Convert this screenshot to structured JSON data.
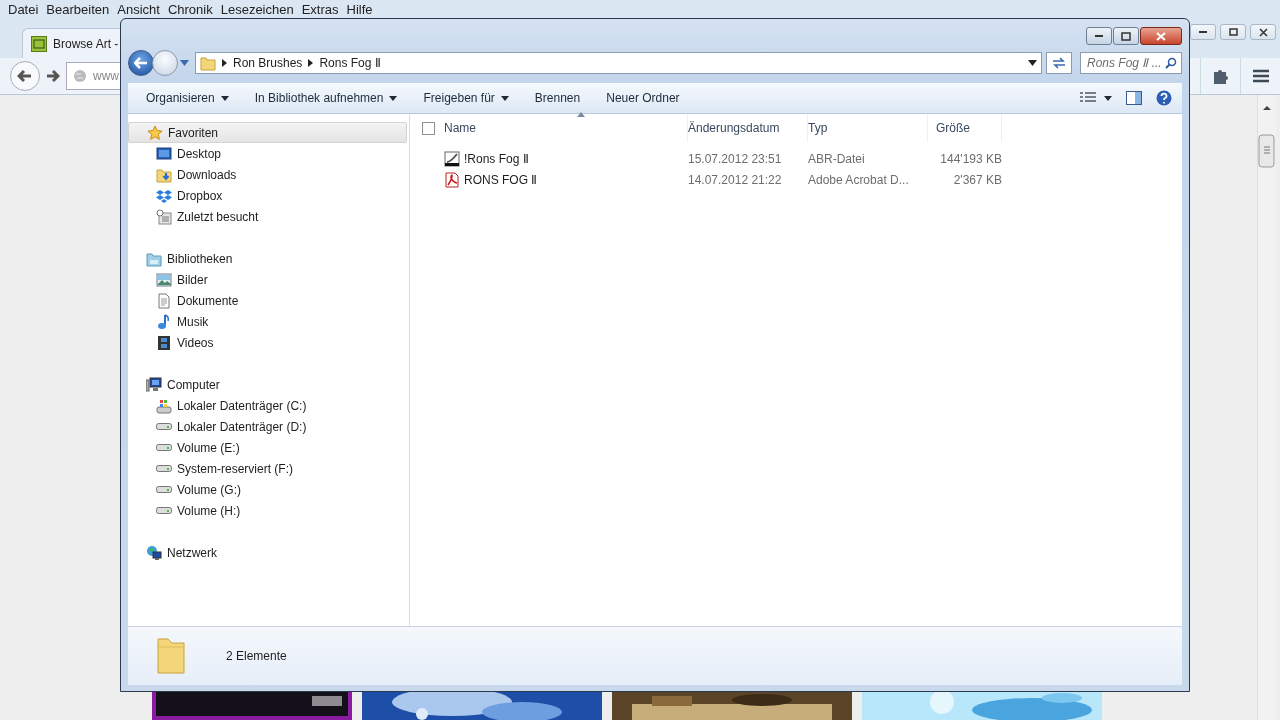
{
  "browser": {
    "menu": [
      "Datei",
      "Bearbeiten",
      "Ansicht",
      "Chronik",
      "Lesezeichen",
      "Extras",
      "Hilfe"
    ],
    "tab": {
      "title": "Browse Art -"
    },
    "url": "www"
  },
  "explorer": {
    "address": {
      "crumbs": [
        "Ron Brushes",
        "Rons Fog Ⅱ"
      ]
    },
    "search": {
      "placeholder": "Rons Fog Ⅱ ..."
    },
    "toolbar": [
      {
        "label": "Organisieren",
        "dropdown": true
      },
      {
        "label": "In Bibliothek aufnehmen",
        "dropdown": true
      },
      {
        "label": "Freigeben für",
        "dropdown": true
      },
      {
        "label": "Brennen",
        "dropdown": false
      },
      {
        "label": "Neuer Ordner",
        "dropdown": false
      }
    ],
    "nav": [
      {
        "label": "Favoriten",
        "kind": "star",
        "highlighted": true,
        "children": [
          {
            "label": "Desktop",
            "kind": "desktop"
          },
          {
            "label": "Downloads",
            "kind": "downloads"
          },
          {
            "label": "Dropbox",
            "kind": "dropbox"
          },
          {
            "label": "Zuletzt besucht",
            "kind": "recent"
          }
        ]
      },
      {
        "label": "Bibliotheken",
        "kind": "library",
        "highlighted": false,
        "children": [
          {
            "label": "Bilder",
            "kind": "pictures"
          },
          {
            "label": "Dokumente",
            "kind": "documents"
          },
          {
            "label": "Musik",
            "kind": "music"
          },
          {
            "label": "Videos",
            "kind": "videos"
          }
        ]
      },
      {
        "label": "Computer",
        "kind": "computer",
        "highlighted": false,
        "children": [
          {
            "label": "Lokaler Datenträger (C:)",
            "kind": "drive-windows"
          },
          {
            "label": "Lokaler Datenträger (D:)",
            "kind": "drive"
          },
          {
            "label": "Volume (E:)",
            "kind": "drive"
          },
          {
            "label": "System-reserviert (F:)",
            "kind": "drive"
          },
          {
            "label": "Volume (G:)",
            "kind": "drive"
          },
          {
            "label": "Volume (H:)",
            "kind": "drive"
          }
        ]
      },
      {
        "label": "Netzwerk",
        "kind": "network",
        "highlighted": false
      }
    ],
    "select_all": {
      "checked": false
    },
    "columns": [
      {
        "label": "Name",
        "sorted": true
      },
      {
        "label": "Änderungsdatum",
        "sorted": false
      },
      {
        "label": "Typ",
        "sorted": false
      },
      {
        "label": "Größe",
        "sorted": false
      }
    ],
    "rows": [
      {
        "kind": "brush",
        "name": "!Rons Fog Ⅱ",
        "date": "15.07.2012 23:51",
        "type": "ABR-Datei",
        "size": "144'193 KB"
      },
      {
        "kind": "pdf",
        "name": "RONS FOG Ⅱ",
        "date": "14.07.2012 21:22",
        "type": "Adobe Acrobat D...",
        "size": "2'367 KB"
      }
    ],
    "status": "2 Elemente"
  }
}
